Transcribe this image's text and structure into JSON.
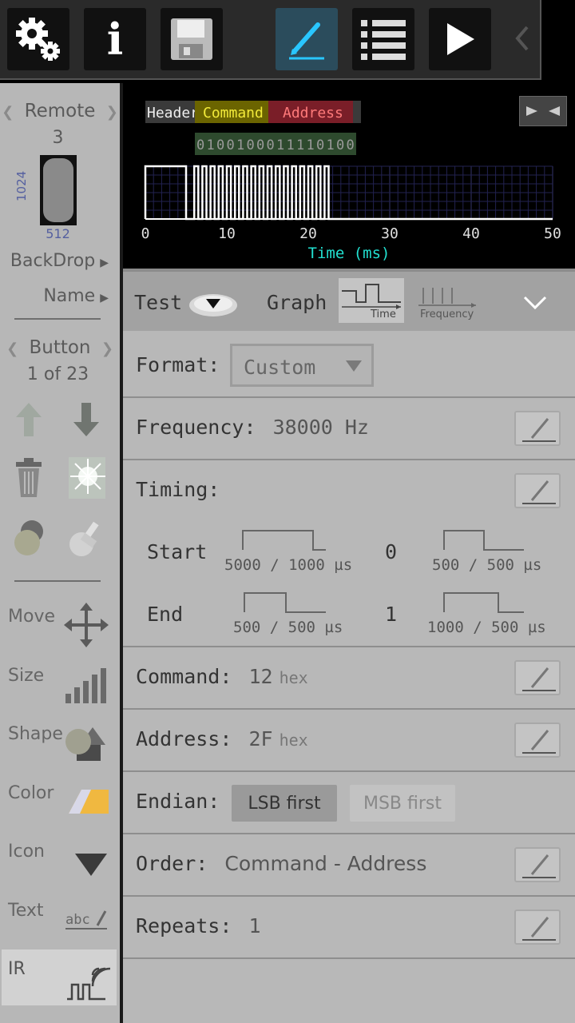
{
  "toolbar": {
    "buttons": [
      "settings-icon",
      "info-icon",
      "save-icon",
      "edit-icon",
      "list-icon",
      "play-icon"
    ],
    "active": "edit-icon",
    "info_glyph": "i"
  },
  "sidebar": {
    "remote": {
      "title": "Remote",
      "number": "3",
      "height": "1024",
      "width": "512"
    },
    "backdrop": "BackDrop",
    "name": "Name",
    "button": {
      "title": "Button",
      "position": "1 of 23"
    },
    "tools": [
      {
        "label": "Move",
        "icon": "move-arrows-icon"
      },
      {
        "label": "Size",
        "icon": "size-bars-icon"
      },
      {
        "label": "Shape",
        "icon": "shape-icon"
      },
      {
        "label": "Color",
        "icon": "color-swatch-icon"
      },
      {
        "label": "Icon",
        "icon": "icon-triangle-icon"
      },
      {
        "label": "Text",
        "icon": "text-abc-icon"
      },
      {
        "label": "IR",
        "icon": "ir-signal-icon"
      }
    ]
  },
  "graph": {
    "segments": {
      "header": "Header",
      "command": "Command",
      "address": "Address"
    },
    "bits": [
      "0",
      "1",
      "0",
      "0",
      "1",
      "0",
      "0",
      "0",
      "1",
      "1",
      "1",
      "1",
      "0",
      "1",
      "0",
      "0"
    ],
    "x_ticks": [
      "0",
      "10",
      "20",
      "30",
      "40",
      "50"
    ],
    "x_label": "Time (ms)"
  },
  "panel": {
    "tabs": {
      "test": "Test",
      "graph": "Graph",
      "time_label": "Time",
      "frequency_label": "Frequency"
    },
    "format": {
      "label": "Format:",
      "value": "Custom"
    },
    "frequency": {
      "label": "Frequency:",
      "value": "38000 Hz"
    },
    "timing": {
      "label": "Timing:",
      "start": {
        "label": "Start",
        "pulse": "5000 / 1000 µs",
        "bit": "0",
        "bit_pulse": "500 / 500 µs"
      },
      "end": {
        "label": "End",
        "pulse": "500 / 500 µs",
        "bit": "1",
        "bit_pulse": "1000 / 500 µs"
      }
    },
    "command": {
      "label": "Command:",
      "value": "12",
      "unit": "hex"
    },
    "address": {
      "label": "Address:",
      "value": "2F",
      "unit": "hex"
    },
    "endian": {
      "label": "Endian:",
      "options": [
        "LSB first",
        "MSB first"
      ],
      "selected": "LSB first"
    },
    "order": {
      "label": "Order:",
      "value": "Command - Address"
    },
    "repeats": {
      "label": "Repeats:",
      "value": "1"
    }
  },
  "colors": {
    "header_bg": "#3a3a3a",
    "command_bg": "#6b6400",
    "command_text": "#f2ea3a",
    "address_bg": "#7a1e28",
    "address_text": "#ff7a7a",
    "bits_bg": "#2e4a2e",
    "axis_label": "#22e0d0",
    "active_button": "#2b4c5c"
  }
}
